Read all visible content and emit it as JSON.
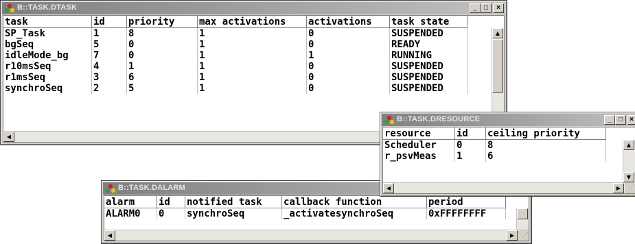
{
  "windows": {
    "dtask": {
      "title": "B::TASK.DTASK",
      "columns": [
        "task",
        "id",
        "priority",
        "max activations",
        "activations",
        "task state"
      ],
      "rows": [
        [
          "SP_Task",
          "1",
          "8",
          "1",
          "0",
          "SUSPENDED"
        ],
        [
          "bgSeq",
          "5",
          "0",
          "1",
          "0",
          "READY"
        ],
        [
          "idleMode_bg",
          "7",
          "0",
          "1",
          "1",
          "RUNNING"
        ],
        [
          "r10msSeq",
          "4",
          "1",
          "1",
          "0",
          "SUSPENDED"
        ],
        [
          "r1msSeq",
          "3",
          "6",
          "1",
          "0",
          "SUSPENDED"
        ],
        [
          "synchroSeq",
          "2",
          "5",
          "1",
          "0",
          "SUSPENDED"
        ]
      ]
    },
    "dresource": {
      "title": "B::TASK.DRESOURCE",
      "columns": [
        "resource",
        "id",
        "ceiling priority"
      ],
      "rows": [
        [
          "Scheduler",
          "0",
          "8"
        ],
        [
          "r_psvMeas",
          "1",
          "6"
        ]
      ]
    },
    "dalarm": {
      "title": "B::TASK.DALARM",
      "columns": [
        "alarm",
        "id",
        "notified task",
        "callback function",
        "period"
      ],
      "rows": [
        [
          "ALARM0",
          "0",
          "synchroSeq",
          "_activatesynchroSeq",
          "0xFFFFFFFF"
        ]
      ]
    }
  },
  "titlebar_buttons": {
    "minimize": "_",
    "maximize": "□",
    "close": "×"
  },
  "scroll_glyphs": {
    "up": "▲",
    "down": "▼",
    "left": "◀",
    "right": "▶",
    "grip": "⋰"
  },
  "colors": {
    "titlebar_inactive": "#808080",
    "window_face": "#d4d0c8",
    "icon_red": "#d22020",
    "icon_green": "#3a9a3a",
    "icon_yellow": "#e8c020"
  }
}
